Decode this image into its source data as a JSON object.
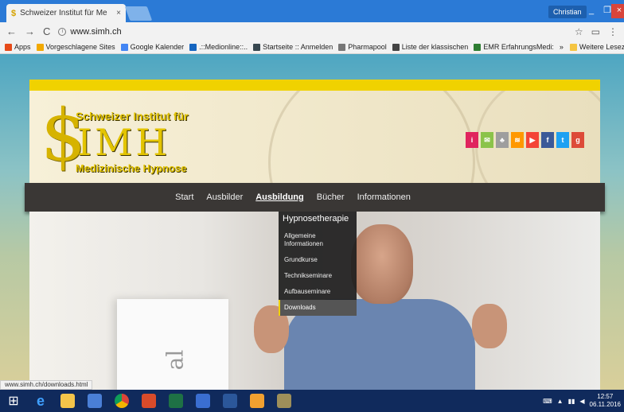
{
  "browser": {
    "tab_title": "Schweizer Institut für Me",
    "tab_close": "×",
    "user_badge": "Christian",
    "win_min": "_",
    "win_max": "❐",
    "win_close": "×",
    "url": "www.simh.ch",
    "status_url": "www.simh.ch/downloads.html"
  },
  "bookmarks": {
    "items": [
      {
        "label": "Apps",
        "color": "#e64a19"
      },
      {
        "label": "Vorgeschlagene Sites",
        "color": "#f2a900"
      },
      {
        "label": "Google Kalender",
        "color": "#4285f4"
      },
      {
        "label": ".::Medionline::..",
        "color": "#1565c0"
      },
      {
        "label": "Startseite :: Anmelden",
        "color": "#37474f"
      },
      {
        "label": "Pharmapool",
        "color": "#777777"
      },
      {
        "label": "Liste der klassischen",
        "color": "#444444"
      },
      {
        "label": "EMR ErfahrungsMedi:",
        "color": "#2e7d32"
      }
    ],
    "more": "»",
    "other": "Weitere Lesezeichen"
  },
  "site": {
    "logo_line1": "Schweizer Institut für",
    "logo_line2": "IMH",
    "logo_line3": "Medizinische Hypnose",
    "logo_dollar": "$",
    "social_colors": [
      "#e0245e",
      "#8bc34a",
      "#9e9e9e",
      "#ff9800",
      "#f44336",
      "#3b5998",
      "#1da1f2",
      "#dd4b39"
    ],
    "nav": {
      "start": "Start",
      "ausbilder": "Ausbilder",
      "ausbildung": "Ausbildung",
      "buecher": "Bücher",
      "informationen": "Informationen"
    },
    "dropdown": {
      "heading": "Hypnosetherapie",
      "items": [
        "Allgemeine Informationen",
        "Grundkurse",
        "Technikseminare",
        "Aufbauseminare",
        "Downloads"
      ],
      "selected_index": 4
    },
    "hero_text": "al"
  },
  "taskbar": {
    "time": "12:57",
    "date": "06.11.2016"
  }
}
